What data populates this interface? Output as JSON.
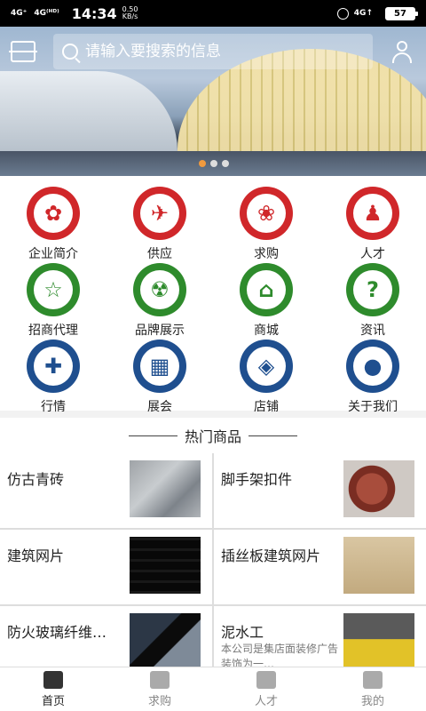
{
  "status_bar": {
    "signal1": "4G⁺",
    "signal2": "4G⁽ᴴᴰ⁾",
    "time": "14:34",
    "speed_value": "0.50",
    "speed_unit": "KB/s",
    "network": "4G↑",
    "battery": "57"
  },
  "search": {
    "placeholder": "请输入要搜索的信息"
  },
  "categories": [
    {
      "label": "企业简介",
      "color": "red",
      "icon": "award-icon",
      "glyph": "✿"
    },
    {
      "label": "供应",
      "color": "red",
      "icon": "bird-icon",
      "glyph": "✈"
    },
    {
      "label": "求购",
      "color": "red",
      "icon": "paw-icon",
      "glyph": "❀"
    },
    {
      "label": "人才",
      "color": "red",
      "icon": "person-icon",
      "glyph": "♟"
    },
    {
      "label": "招商代理",
      "color": "green",
      "icon": "star-icon",
      "glyph": "☆"
    },
    {
      "label": "品牌展示",
      "color": "green",
      "icon": "radiation-icon",
      "glyph": "☢"
    },
    {
      "label": "商城",
      "color": "green",
      "icon": "house-icon",
      "glyph": "⌂"
    },
    {
      "label": "资讯",
      "color": "green",
      "icon": "question-icon",
      "glyph": "?"
    },
    {
      "label": "行情",
      "color": "blue",
      "icon": "puzzle-icon",
      "glyph": "✚"
    },
    {
      "label": "展会",
      "color": "blue",
      "icon": "building-icon",
      "glyph": "▦"
    },
    {
      "label": "店铺",
      "color": "blue",
      "icon": "grid-diamond-icon",
      "glyph": "◈"
    },
    {
      "label": "关于我们",
      "color": "blue",
      "icon": "user-circle-icon",
      "glyph": "●"
    }
  ],
  "hot_section": {
    "title": "热门商品"
  },
  "products": [
    {
      "name": "仿古青砖",
      "desc": "",
      "img": "img-brick"
    },
    {
      "name": "脚手架扣件",
      "desc": "",
      "img": "img-clamp"
    },
    {
      "name": "建筑网片",
      "desc": "",
      "img": "img-mesh"
    },
    {
      "name": "插丝板建筑网片",
      "desc": "",
      "img": "img-board"
    },
    {
      "name": "防火玻璃纤维…",
      "desc": "",
      "img": "img-glass"
    },
    {
      "name": "泥水工",
      "desc": "本公司是集店面装修广告装饰为一…",
      "img": "img-worker"
    }
  ],
  "tabs": [
    {
      "label": "首页",
      "icon": "home-icon",
      "active": true
    },
    {
      "label": "求购",
      "icon": "hand-icon",
      "active": false
    },
    {
      "label": "人才",
      "icon": "graduate-icon",
      "active": false
    },
    {
      "label": "我的",
      "icon": "profile-icon",
      "active": false
    }
  ]
}
